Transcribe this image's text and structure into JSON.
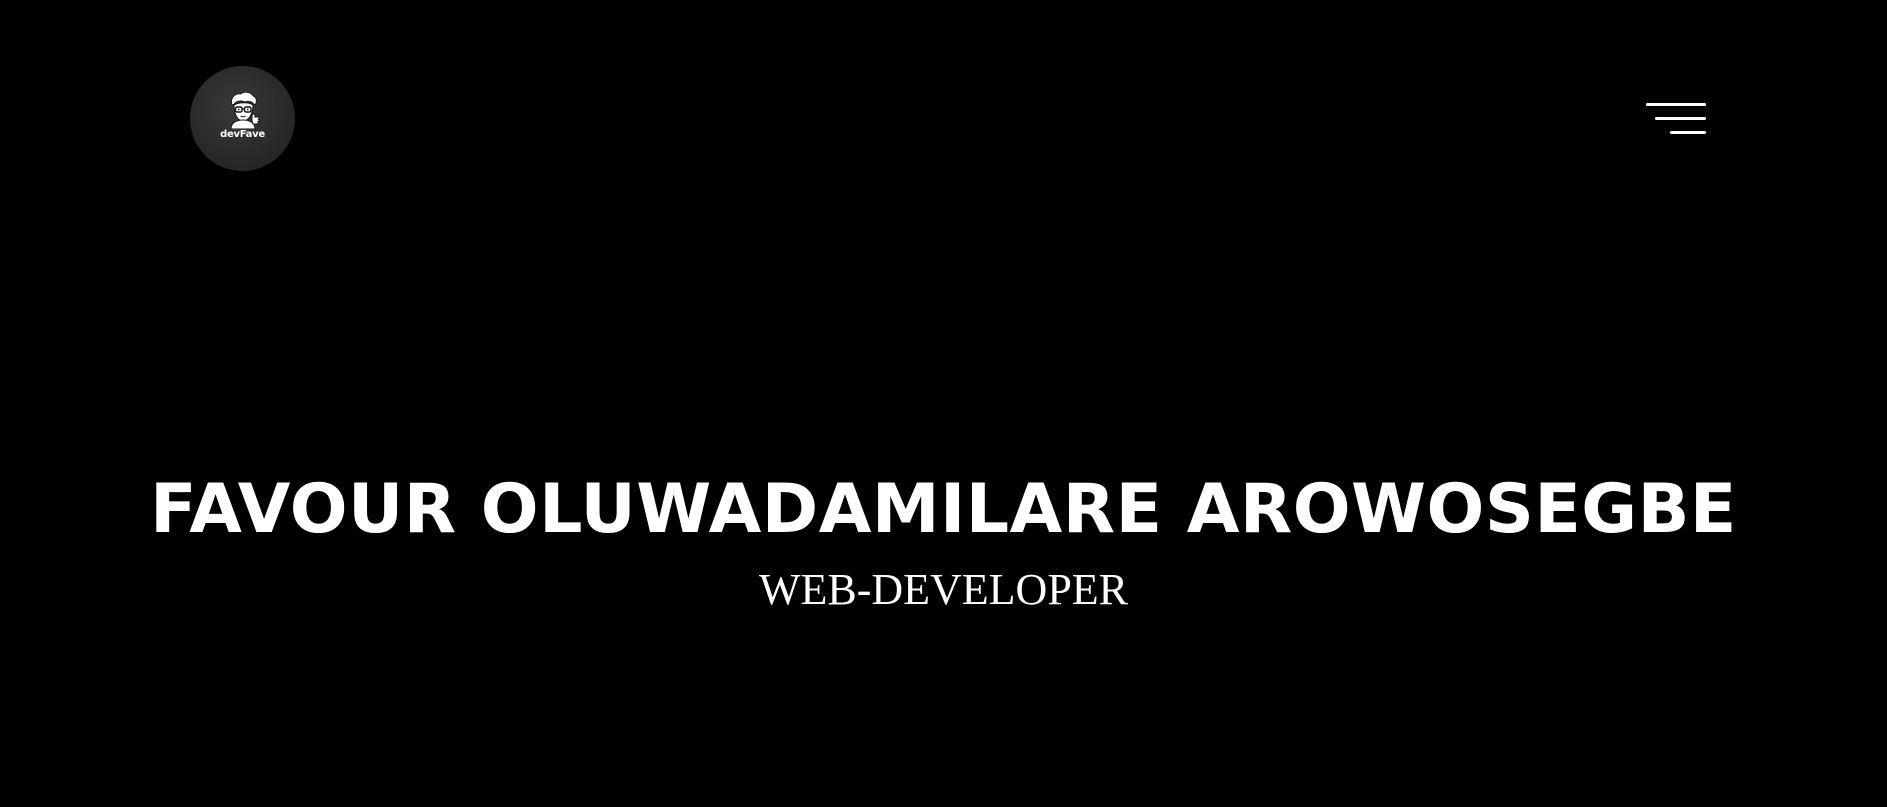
{
  "theme": {
    "background": "#000000",
    "text": "#ffffff",
    "logo_bg": "#2a2a2a"
  },
  "header": {
    "logo": {
      "text": "devFave",
      "icon": "developer-avatar-icon"
    },
    "menu": {
      "icon": "hamburger-menu-icon"
    }
  },
  "hero": {
    "name": "FAVOUR OLUWADAMILARE AROWOSEGBE",
    "role": "WEB-DEVELOPER"
  }
}
